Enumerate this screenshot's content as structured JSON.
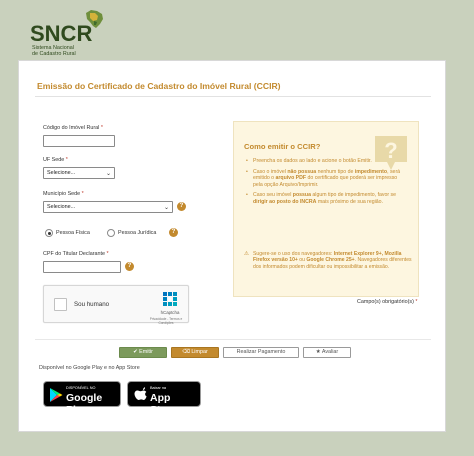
{
  "header": {
    "logo_text": "SNCR",
    "logo_sub_line1": "Sistema Nacional",
    "logo_sub_line2": "de Cadastro Rural"
  },
  "page": {
    "title": "Emissão do Certificado de Cadastro do Imóvel Rural (CCIR)"
  },
  "form": {
    "codigo_label": "Código do Imóvel Rural",
    "uf_label": "UF Sede",
    "uf_value": "Selecione...",
    "municipio_label": "Município Sede",
    "municipio_value": "Selecione...",
    "pessoa_fisica": "Pessoa Física",
    "pessoa_juridica": "Pessoa Jurídica",
    "cpf_label": "CPF do Titular Declarante",
    "required_mark": "*",
    "help_mark": "?"
  },
  "captcha": {
    "text": "Sou humano",
    "brand": "hCaptcha",
    "links": "Privacidade - Termos e Condições"
  },
  "info": {
    "title": "Como emitir o CCIR?",
    "item1": "Preencha os dados ao lado e acione o botão Emitir.",
    "item2_a": "Caso o imóvel ",
    "item2_b": "não possua",
    "item2_c": " nenhum tipo de ",
    "item2_d": "impedimento",
    "item2_e": ", será emitido o ",
    "item2_f": "arquivo PDF",
    "item2_g": " do certificado que poderá ser impresso pela opção Arquivo/Imprimir.",
    "item3_a": "Caso seu imóvel ",
    "item3_b": "possua",
    "item3_c": " algum tipo de impedimento, favor se ",
    "item3_d": "dirigir ao posto do INCRA",
    "item3_e": " mais próximo de sua região.",
    "note_a": "Sugere-se o uso dos navegadores: ",
    "note_b": "Internet Explorer 9+, Mozilla Firefox versão 10+",
    "note_c": " ou ",
    "note_d": "Google Chrome 25+",
    "note_e": ". Navegadores diferentes dos informados podem dificultar ou impossibilitar a emissão."
  },
  "required_note": "Campo(s) obrigatório(s)",
  "buttons": {
    "emitir": "Emitir",
    "limpar": "Limpar",
    "pagamento": "Realizar Pagamento",
    "avaliar": "Avaliar"
  },
  "stores": {
    "caption": "Disponível no Google Play e no App Store",
    "gp_small": "DISPONÍVEL NO",
    "gp_big": "Google Play",
    "as_small": "Baixar na",
    "as_big": "App Store"
  }
}
